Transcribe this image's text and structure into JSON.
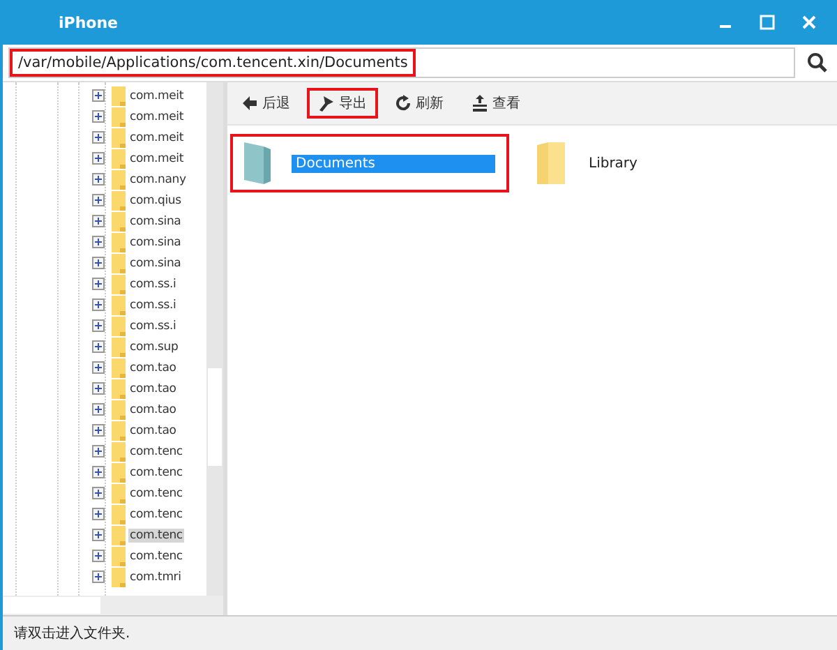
{
  "window": {
    "title": "iPhone"
  },
  "address": {
    "value": "/var/mobile/Applications/com.tencent.xin/Documents",
    "highlighted": true
  },
  "tree": [
    {
      "label": "com.meit",
      "selected": false
    },
    {
      "label": "com.meit",
      "selected": false
    },
    {
      "label": "com.meit",
      "selected": false
    },
    {
      "label": "com.meit",
      "selected": false
    },
    {
      "label": "com.nany",
      "selected": false
    },
    {
      "label": "com.qius",
      "selected": false
    },
    {
      "label": "com.sina",
      "selected": false
    },
    {
      "label": "com.sina",
      "selected": false
    },
    {
      "label": "com.sina",
      "selected": false
    },
    {
      "label": "com.ss.i",
      "selected": false
    },
    {
      "label": "com.ss.i",
      "selected": false
    },
    {
      "label": "com.ss.i",
      "selected": false
    },
    {
      "label": "com.sup",
      "selected": false
    },
    {
      "label": "com.tao",
      "selected": false
    },
    {
      "label": "com.tao",
      "selected": false
    },
    {
      "label": "com.tao",
      "selected": false
    },
    {
      "label": "com.tao",
      "selected": false
    },
    {
      "label": "com.tenc",
      "selected": false
    },
    {
      "label": "com.tenc",
      "selected": false
    },
    {
      "label": "com.tenc",
      "selected": false
    },
    {
      "label": "com.tenc",
      "selected": false
    },
    {
      "label": "com.tenc",
      "selected": true
    },
    {
      "label": "com.tenc",
      "selected": false
    },
    {
      "label": "com.tmri",
      "selected": false
    }
  ],
  "toolbar": [
    {
      "kind": "back",
      "label": "后退",
      "highlighted": false
    },
    {
      "kind": "export",
      "label": "导出",
      "highlighted": true
    },
    {
      "kind": "refresh",
      "label": "刷新",
      "highlighted": false
    },
    {
      "kind": "view",
      "label": "查看",
      "highlighted": false
    }
  ],
  "files": [
    {
      "name": "Documents",
      "kind": "folder-open",
      "selected": true,
      "highlighted": true
    },
    {
      "name": "Library",
      "kind": "folder",
      "selected": false,
      "highlighted": false
    }
  ],
  "status_bar": "请双击进入文件夹."
}
